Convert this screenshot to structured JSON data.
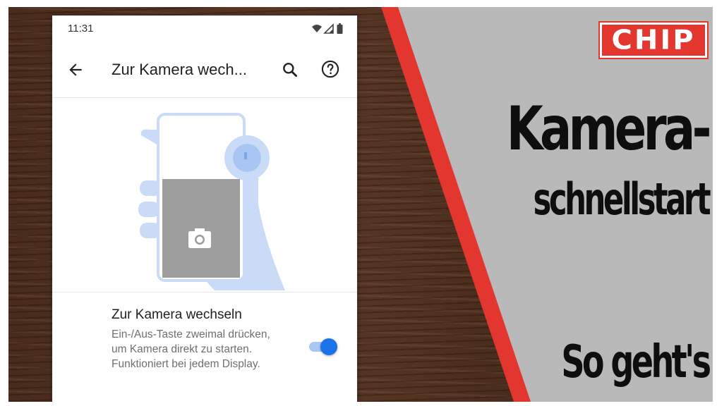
{
  "status_bar": {
    "time": "11:31"
  },
  "app_bar": {
    "title": "Zur Kamera wech..."
  },
  "setting": {
    "title": "Zur Kamera wechseln",
    "description": "Ein-/Aus-Taste zweimal drücken, um Kamera direkt zu starten. Funktioniert bei jedem Display.",
    "enabled": true
  },
  "overlay": {
    "logo": "CHIP",
    "headline_line1": "Kamera-",
    "headline_line2": "schnellstart",
    "tagline": "So geht's"
  },
  "colors": {
    "accent": "#1a73e8",
    "brand_red": "#e3362f",
    "panel_gray": "#b9b9b9"
  },
  "icons": [
    "back-arrow-icon",
    "search-icon",
    "help-icon",
    "wifi-icon",
    "signal-icon",
    "battery-icon",
    "camera-icon"
  ]
}
